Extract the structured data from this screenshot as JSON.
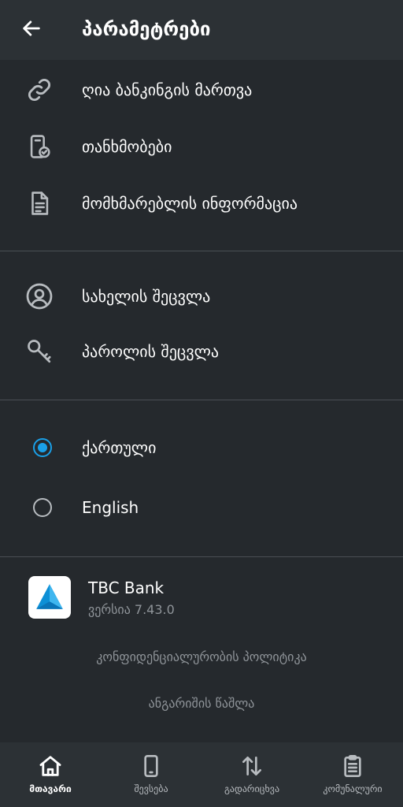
{
  "header": {
    "title": "პარამეტრები",
    "back_icon": "arrow-left-icon"
  },
  "section_account": [
    {
      "label": "ღია ბანკინგის მართვა",
      "icon": "link-icon"
    },
    {
      "label": "თანხმობები",
      "icon": "phone-check-icon"
    },
    {
      "label": "მომხმარებლის ინფორმაცია",
      "icon": "document-icon"
    }
  ],
  "section_security": [
    {
      "label": "სახელის შეცვლა",
      "icon": "user-circle-icon"
    },
    {
      "label": "პაროლის შეცვლა",
      "icon": "key-icon"
    }
  ],
  "language": {
    "options": [
      {
        "label": "ქართული",
        "selected": true
      },
      {
        "label": "English",
        "selected": false
      }
    ]
  },
  "app_info": {
    "name": "TBC Bank",
    "version": "ვერსია 7.43.0"
  },
  "links": {
    "privacy_policy": "კონფიდენციალურობის პოლიტიკა",
    "delete_account": "ანგარიშის წაშლა"
  },
  "bottom_nav": [
    {
      "label": "მთავარი",
      "icon": "home-icon",
      "active": true
    },
    {
      "label": "შევსება",
      "icon": "phone-icon",
      "active": false
    },
    {
      "label": "გადარიცხვა",
      "icon": "transfer-arrows-icon",
      "active": false
    },
    {
      "label": "კომუნალური",
      "icon": "clipboard-icon",
      "active": false
    }
  ],
  "colors": {
    "background": "#25292d",
    "header_bg": "#2c3135",
    "accent": "#1aa0e8",
    "muted_text": "#8f9499",
    "icon": "#b8bcc0"
  }
}
